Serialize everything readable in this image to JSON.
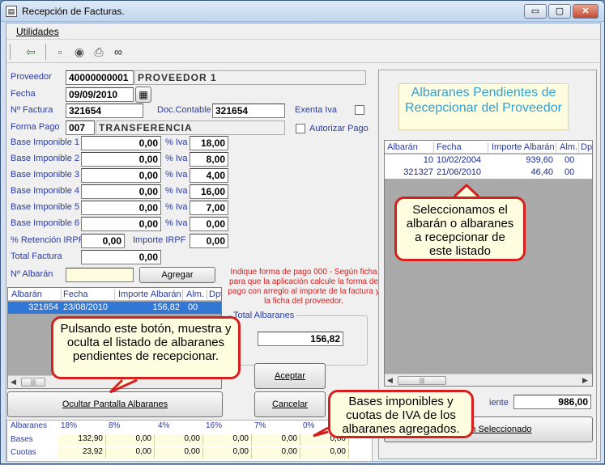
{
  "window": {
    "title": "Recepción de Facturas.",
    "app_icon": "form-icon",
    "controls": {
      "minimize": "▭",
      "maximize": "▢",
      "close": "✕"
    }
  },
  "menu": {
    "utilidades": "Utilidades"
  },
  "toolbar": {
    "icons": [
      "exit-door-icon",
      "document-icon",
      "eye-icon",
      "printer-icon",
      "binoculars-icon"
    ]
  },
  "form": {
    "proveedor_label": "Proveedor",
    "proveedor_code": "40000000001",
    "proveedor_name": "PROVEEDOR 1",
    "fecha_label": "Fecha",
    "fecha_value": "09/09/2010",
    "calendar_icon": "calendar-icon",
    "nfactura_label": "Nº Factura",
    "nfactura_value": "321654",
    "doc_contable_label": "Doc.Contable",
    "doc_contable_value": "321654",
    "exenta_label": "Exenta Iva",
    "forma_pago_label": "Forma Pago",
    "forma_pago_code": "007",
    "forma_pago_name": "TRANSFERENCIA",
    "autorizar_label": "Autorizar Pago",
    "iva_label": "% Iva",
    "bases": [
      {
        "label": "Base Imponible 1",
        "value": "0,00",
        "iva": "18,00"
      },
      {
        "label": "Base Imponible 2",
        "value": "0,00",
        "iva": "8,00"
      },
      {
        "label": "Base Imponible 3",
        "value": "0,00",
        "iva": "4,00"
      },
      {
        "label": "Base Imponible 4",
        "value": "0,00",
        "iva": "16,00"
      },
      {
        "label": "Base Imponible 5",
        "value": "0,00",
        "iva": "7,00"
      },
      {
        "label": "Base Imponible 6",
        "value": "0,00",
        "iva": "0,00"
      }
    ],
    "retencion_label": "% Retención IRPF",
    "retencion_value": "0,00",
    "importe_irpf_label": "Importe IRPF",
    "importe_irpf_value": "0,00",
    "total_factura_label": "Total Factura",
    "total_factura_value": "0,00",
    "nalbaran_label": "Nº Albarán",
    "nalbaran_value": "",
    "agregar_label": "Agregar"
  },
  "note_text": "Indique forma de pago 000 - Según ficha  para que la aplicación calcule la forma de pago con arreglo al importe de la factura y la ficha del proveedor.",
  "left_grid": {
    "columns": [
      "Albarán",
      "Fecha",
      "Importe Albarán",
      "Alm.",
      "Dpt"
    ],
    "rows": [
      {
        "albaran": "321654",
        "fecha": "23/08/2010",
        "importe": "156,82",
        "alm": "00"
      }
    ]
  },
  "total_albaranes": {
    "label": "Total Albaranes",
    "value": "156,82"
  },
  "buttons": {
    "aceptar": "Aceptar",
    "cancelar": "Cancelar",
    "ocultar": "Ocultar Pantalla Albaranes",
    "seleccionado": "Albarán Seleccionado"
  },
  "right_panel": {
    "title": "Albaranes Pendientes de Recepcionar del Proveedor",
    "columns": [
      "Albarán",
      "Fecha",
      "Importe Albarán",
      "Alm.",
      "Dp"
    ],
    "rows": [
      {
        "albaran": "10",
        "fecha": "10/02/2004",
        "importe": "939,60",
        "alm": "00"
      },
      {
        "albaran": "321327",
        "fecha": "21/06/2010",
        "importe": "46,40",
        "alm": "00"
      }
    ],
    "pendiente_label": "iente",
    "pendiente_value": "986,00"
  },
  "bottom_grid": {
    "row_label": "Albaranes",
    "headers": [
      "18%",
      "8%",
      "4%",
      "16%",
      "7%",
      "0%"
    ],
    "bases_label": "Bases",
    "bases": [
      "132,90",
      "0,00",
      "0,00",
      "0,00",
      "0,00",
      "0,00"
    ],
    "cuotas_label": "Cuotas",
    "cuotas": [
      "23,92",
      "0,00",
      "0,00",
      "0,00",
      "0,00",
      "0,00"
    ]
  },
  "callouts": {
    "right": "Seleccionamos el albarán o albaranes a recepcionar de este listado",
    "left": "Pulsando este botón, muestra y oculta el listado de albaranes pendientes de recepcionar.",
    "bottom": "Bases imponibles y cuotas de IVA de los albaranes agregados."
  },
  "colors": {
    "label_blue": "#2b3b9e",
    "callout_border": "#d52020",
    "callout_fill": "#fffde0",
    "title_cyan": "#2ea0d8",
    "selection": "#3177d6"
  }
}
